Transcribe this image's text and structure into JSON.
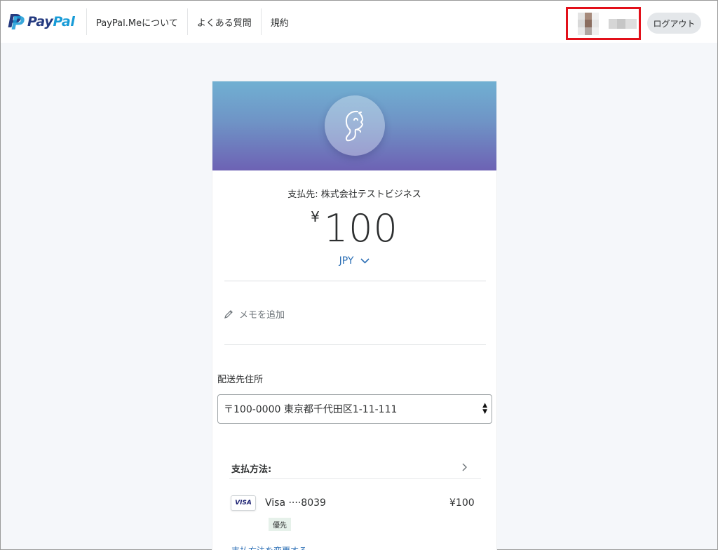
{
  "header": {
    "brand": {
      "pay": "Pay",
      "pal": "Pal"
    },
    "nav": [
      {
        "label": "PayPal.Meについて"
      },
      {
        "label": "よくある質問"
      },
      {
        "label": "規約"
      }
    ],
    "logout_label": "ログアウト"
  },
  "payment": {
    "payee": "支払先: 株式会社テストビジネス",
    "currency_symbol": "¥",
    "amount": "100",
    "currency": "JPY",
    "memo_placeholder": "メモを追加"
  },
  "shipping": {
    "label": "配送先住所",
    "selected_address": "〒100-0000 東京都千代田区1-11-111"
  },
  "payment_method": {
    "heading": "支払方法:",
    "card_brand": "VISA",
    "card_label": "Visa ····8039",
    "card_amount": "¥100",
    "preferred_badge": "優先",
    "change_link": "支払方法を変更する"
  },
  "colors": {
    "brand_dark": "#253b80",
    "brand_light": "#179bd7",
    "link_blue": "#2c6fb5",
    "highlight_red": "#e2101a"
  }
}
